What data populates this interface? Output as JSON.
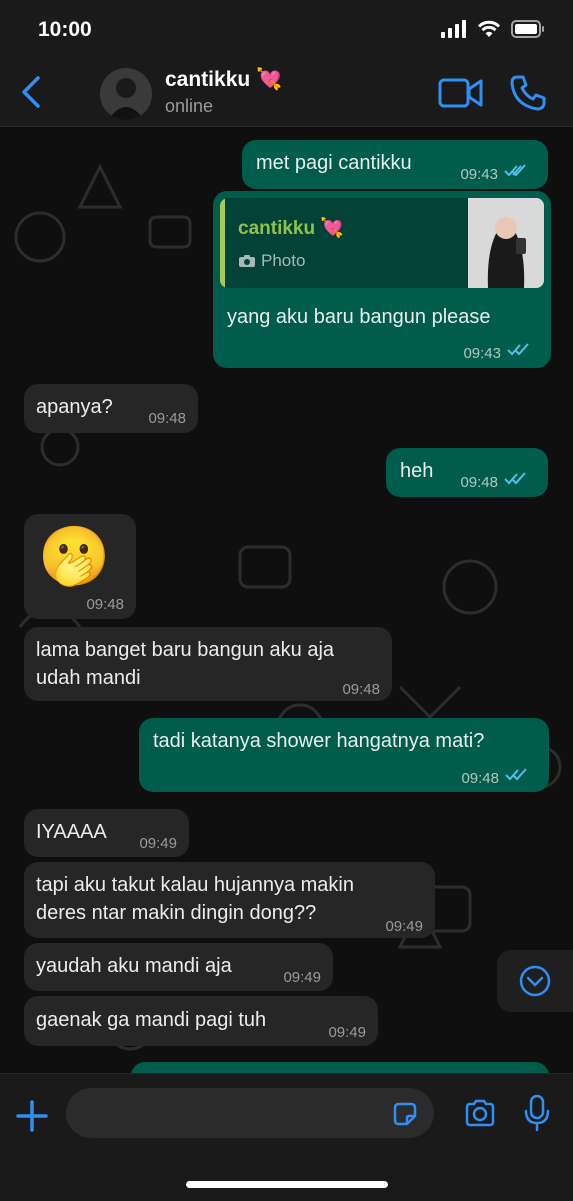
{
  "status_bar": {
    "time": "10:00"
  },
  "header": {
    "contact_name": "cantikku 💘",
    "contact_status": "online"
  },
  "messages": [
    {
      "text": "met pagi cantikku",
      "time": "09:43"
    },
    {
      "reply_name": "cantikku 💘",
      "reply_type": "Photo",
      "text": "yang aku baru bangun please",
      "time": "09:43"
    },
    {
      "text": "apanya?",
      "time": "09:48"
    },
    {
      "text": "heh",
      "time": "09:48"
    },
    {
      "text": "🫢",
      "time": "09:48"
    },
    {
      "line1": "lama banget baru bangun aku aja",
      "line2": "udah mandi",
      "time": "09:48"
    },
    {
      "text": "tadi katanya shower hangatnya mati?",
      "time": "09:48"
    },
    {
      "text": "IYAAAA",
      "time": "09:49"
    },
    {
      "line1": "tapi aku takut kalau hujannya makin",
      "line2": "deres ntar makin dingin dong??",
      "time": "09:49"
    },
    {
      "text": "yaudah aku mandi aja",
      "time": "09:49"
    },
    {
      "text": "gaenak ga mandi pagi tuh",
      "time": "09:49"
    }
  ],
  "composer": {
    "placeholder": ""
  },
  "colors": {
    "accent": "#2f8ff5",
    "outgoing": "#005c4b",
    "incoming": "#262626",
    "reply_name": "#8fc14f"
  }
}
